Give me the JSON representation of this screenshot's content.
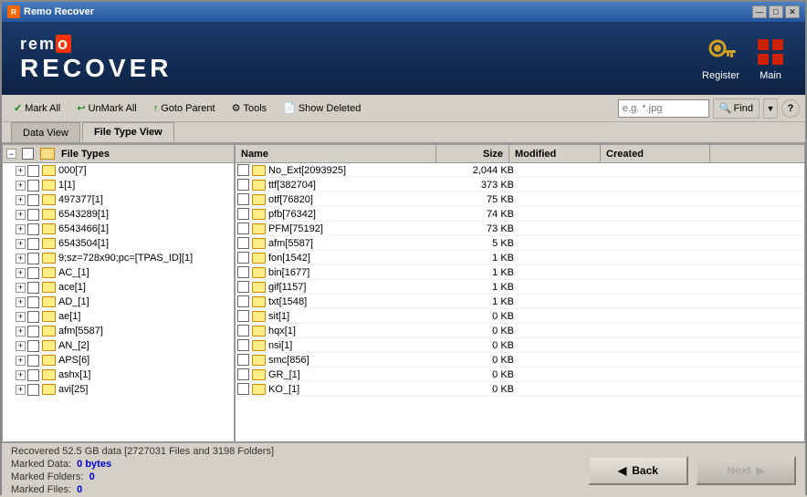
{
  "window": {
    "title": "Remo Recover",
    "controls": [
      "—",
      "□",
      "✕"
    ]
  },
  "logo": {
    "remo": "remo",
    "remo_highlight": "o",
    "recover": "RECOVER"
  },
  "header_buttons": [
    {
      "id": "register",
      "label": "Register",
      "icon": "key"
    },
    {
      "id": "main",
      "label": "Main",
      "icon": "grid"
    }
  ],
  "toolbar": {
    "buttons": [
      {
        "id": "mark-all",
        "icon": "✓",
        "label": "Mark All"
      },
      {
        "id": "unmark-all",
        "icon": "↩",
        "label": "UnMark All"
      },
      {
        "id": "goto-parent",
        "icon": "↑",
        "label": "Goto Parent"
      },
      {
        "id": "tools",
        "icon": "⚙",
        "label": "Tools"
      },
      {
        "id": "show-deleted",
        "icon": "📄",
        "label": "Show Deleted"
      }
    ],
    "search_placeholder": "e.g. *.jpg",
    "find_label": "Find",
    "help_label": "?"
  },
  "tabs": [
    {
      "id": "data-view",
      "label": "Data View",
      "active": false
    },
    {
      "id": "file-type-view",
      "label": "File Type View",
      "active": true
    }
  ],
  "tree": {
    "root_label": "File Types",
    "items": [
      {
        "label": "000[7]",
        "indent": 1
      },
      {
        "label": "1[1]",
        "indent": 1
      },
      {
        "label": "497377[1]",
        "indent": 1
      },
      {
        "label": "6543289[1]",
        "indent": 1
      },
      {
        "label": "6543466[1]",
        "indent": 1
      },
      {
        "label": "6543504[1]",
        "indent": 1
      },
      {
        "label": "9;sz=728x90;pc=[TPAS_ID][1]",
        "indent": 1
      },
      {
        "label": "AC_[1]",
        "indent": 1
      },
      {
        "label": "ace[1]",
        "indent": 1
      },
      {
        "label": "AD_[1]",
        "indent": 1
      },
      {
        "label": "ae[1]",
        "indent": 1
      },
      {
        "label": "afm[5587]",
        "indent": 1
      },
      {
        "label": "AN_[2]",
        "indent": 1
      },
      {
        "label": "APS[6]",
        "indent": 1
      },
      {
        "label": "ashx[1]",
        "indent": 1
      },
      {
        "label": "avi[25]",
        "indent": 1
      },
      {
        "label": "...",
        "indent": 1
      }
    ]
  },
  "file_list": {
    "columns": [
      "Name",
      "Size",
      "Modified",
      "Created"
    ],
    "rows": [
      {
        "name": "No_Ext[2093925]",
        "size": "2,044 KB",
        "modified": "",
        "created": ""
      },
      {
        "name": "ttf[382704]",
        "size": "373 KB",
        "modified": "",
        "created": ""
      },
      {
        "name": "otf[76820]",
        "size": "75 KB",
        "modified": "",
        "created": ""
      },
      {
        "name": "pfb[76342]",
        "size": "74 KB",
        "modified": "",
        "created": ""
      },
      {
        "name": "PFM[75192]",
        "size": "73 KB",
        "modified": "",
        "created": ""
      },
      {
        "name": "afm[5587]",
        "size": "5 KB",
        "modified": "",
        "created": ""
      },
      {
        "name": "fon[1542]",
        "size": "1 KB",
        "modified": "",
        "created": ""
      },
      {
        "name": "bin[1677]",
        "size": "1 KB",
        "modified": "",
        "created": ""
      },
      {
        "name": "gif[1157]",
        "size": "1 KB",
        "modified": "",
        "created": ""
      },
      {
        "name": "txt[1548]",
        "size": "1 KB",
        "modified": "",
        "created": ""
      },
      {
        "name": "sit[1]",
        "size": "0 KB",
        "modified": "",
        "created": ""
      },
      {
        "name": "hqx[1]",
        "size": "0 KB",
        "modified": "",
        "created": ""
      },
      {
        "name": "nsi[1]",
        "size": "0 KB",
        "modified": "",
        "created": ""
      },
      {
        "name": "smc[856]",
        "size": "0 KB",
        "modified": "",
        "created": ""
      },
      {
        "name": "GR_[1]",
        "size": "0 KB",
        "modified": "",
        "created": ""
      },
      {
        "name": "KO_[1]",
        "size": "0 KB",
        "modified": "",
        "created": ""
      }
    ]
  },
  "status": {
    "main": "Recovered 52.5 GB data [2727031 Files and 3198 Folders]",
    "marked_data_label": "Marked Data:",
    "marked_data_value": "0 bytes",
    "marked_folders_label": "Marked Folders:",
    "marked_folders_value": "0",
    "marked_files_label": "Marked Files:",
    "marked_files_value": "0"
  },
  "navigation": {
    "back_label": "Back",
    "next_label": "Next"
  },
  "colors": {
    "accent_blue": "#2355a0",
    "folder_yellow": "#ffff99",
    "active_tab_bg": "#d4d0c8"
  }
}
